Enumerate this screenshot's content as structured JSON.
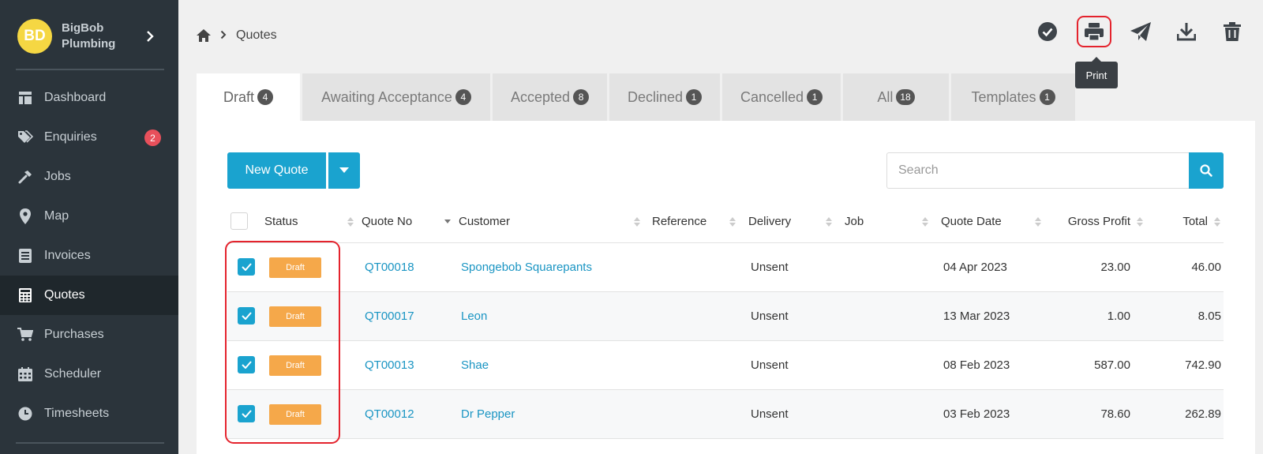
{
  "sidebar": {
    "avatar_initials": "BD",
    "company_name": "BigBob Plumbing",
    "nav": [
      {
        "label": "Dashboard",
        "icon": "dashboard-icon"
      },
      {
        "label": "Enquiries",
        "icon": "tags-icon",
        "badge": "2"
      },
      {
        "label": "Jobs",
        "icon": "hammer-icon"
      },
      {
        "label": "Map",
        "icon": "map-marker-icon"
      },
      {
        "label": "Invoices",
        "icon": "invoice-icon"
      },
      {
        "label": "Quotes",
        "icon": "calculator-icon",
        "active": true
      },
      {
        "label": "Purchases",
        "icon": "cart-icon"
      },
      {
        "label": "Scheduler",
        "icon": "calendar-icon"
      },
      {
        "label": "Timesheets",
        "icon": "clock-icon"
      }
    ]
  },
  "breadcrumb": {
    "current": "Quotes"
  },
  "toolbar": {
    "tooltip": "Print",
    "actions": [
      "check-circle-icon",
      "print-icon",
      "send-icon",
      "download-icon",
      "trash-icon"
    ]
  },
  "tabs": [
    {
      "label": "Draft",
      "count": "4"
    },
    {
      "label": "Awaiting Acceptance",
      "count": "4"
    },
    {
      "label": "Accepted",
      "count": "8"
    },
    {
      "label": "Declined",
      "count": "1"
    },
    {
      "label": "Cancelled",
      "count": "1"
    },
    {
      "label": "All",
      "count": "18"
    },
    {
      "label": "Templates",
      "count": "1"
    }
  ],
  "actions": {
    "new_quote": "New Quote"
  },
  "search": {
    "placeholder": "Search",
    "value": ""
  },
  "table": {
    "columns": [
      "Status",
      "Quote No",
      "Customer",
      "Reference",
      "Delivery",
      "Job",
      "Quote Date",
      "Gross Profit",
      "Total"
    ],
    "rows": [
      {
        "status": "Draft",
        "quote_no": "QT00018",
        "customer": "Spongebob Squarepants",
        "reference": "",
        "delivery": "Unsent",
        "job": "",
        "quote_date": "04 Apr 2023",
        "gross_profit": "23.00",
        "total": "46.00"
      },
      {
        "status": "Draft",
        "quote_no": "QT00017",
        "customer": "Leon",
        "reference": "",
        "delivery": "Unsent",
        "job": "",
        "quote_date": "13 Mar 2023",
        "gross_profit": "1.00",
        "total": "8.05"
      },
      {
        "status": "Draft",
        "quote_no": "QT00013",
        "customer": "Shae",
        "reference": "",
        "delivery": "Unsent",
        "job": "",
        "quote_date": "08 Feb 2023",
        "gross_profit": "587.00",
        "total": "742.90"
      },
      {
        "status": "Draft",
        "quote_no": "QT00012",
        "customer": "Dr Pepper",
        "reference": "",
        "delivery": "Unsent",
        "job": "",
        "quote_date": "03 Feb 2023",
        "gross_profit": "78.60",
        "total": "262.89"
      }
    ]
  },
  "colors": {
    "sidebar_bg": "#2b343b",
    "accent": "#1aa3cf",
    "draft_badge": "#f5a84a",
    "highlight": "#e4232d",
    "badge_red": "#e8505b"
  }
}
